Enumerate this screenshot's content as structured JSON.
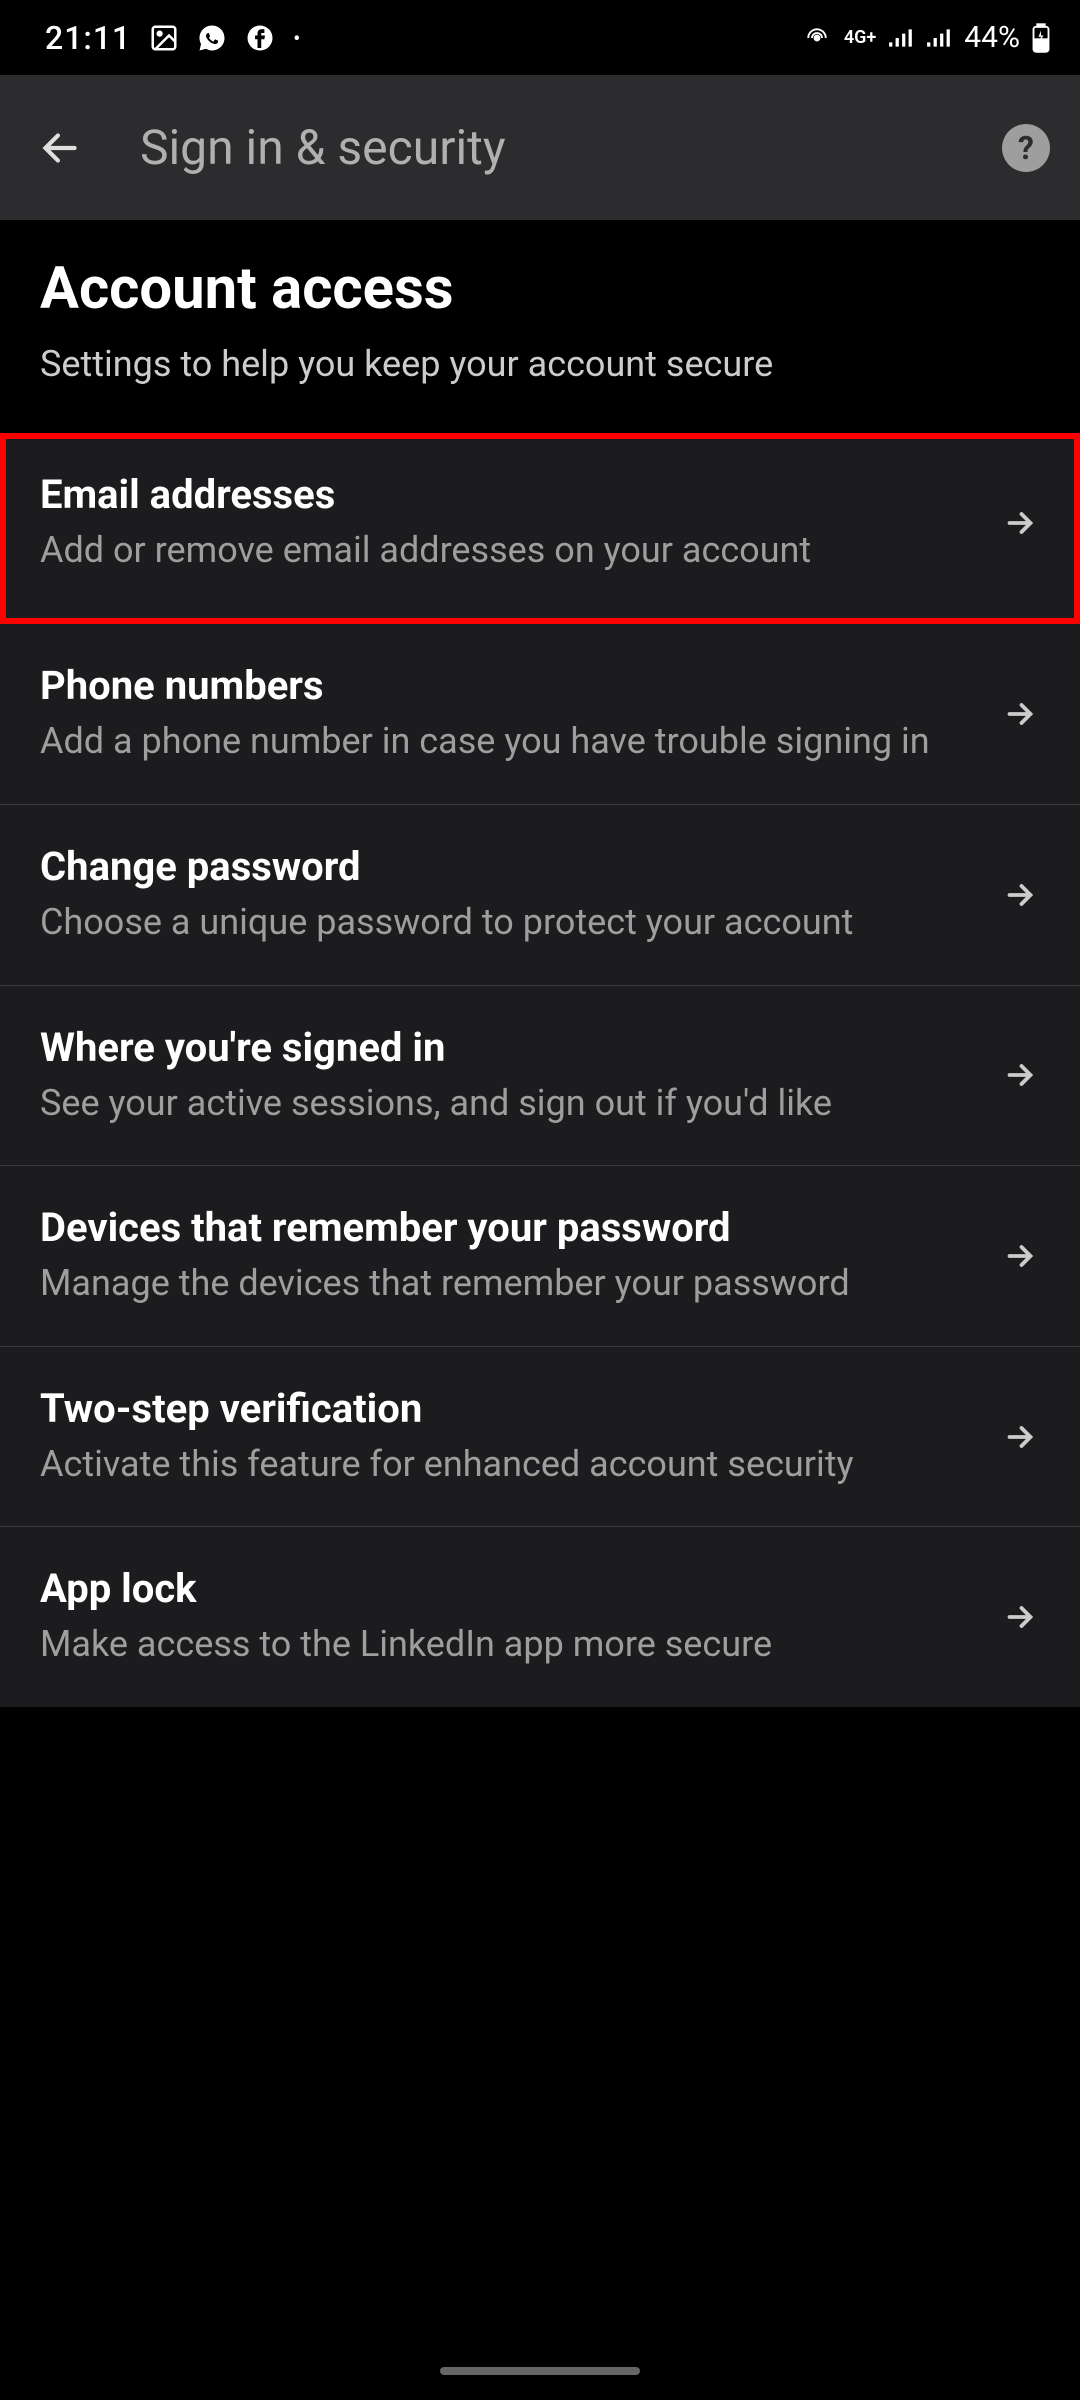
{
  "status": {
    "time": "21:11",
    "network": "4G+",
    "battery": "44%"
  },
  "appbar": {
    "title": "Sign in & security"
  },
  "header": {
    "title": "Account access",
    "subtitle": "Settings to help you keep your account secure"
  },
  "items": [
    {
      "title": "Email addresses",
      "subtitle": "Add or remove email addresses on your account",
      "highlighted": true
    },
    {
      "title": "Phone numbers",
      "subtitle": "Add a phone number in case you have trouble signing in",
      "highlighted": false
    },
    {
      "title": "Change password",
      "subtitle": "Choose a unique password to protect your account",
      "highlighted": false
    },
    {
      "title": "Where you're signed in",
      "subtitle": "See your active sessions, and sign out if you'd like",
      "highlighted": false
    },
    {
      "title": "Devices that remember your password",
      "subtitle": "Manage the devices that remember your password",
      "highlighted": false
    },
    {
      "title": "Two-step verification",
      "subtitle": "Activate this feature for enhanced account security",
      "highlighted": false
    },
    {
      "title": "App lock",
      "subtitle": "Make access to the LinkedIn app more secure",
      "highlighted": false
    }
  ]
}
